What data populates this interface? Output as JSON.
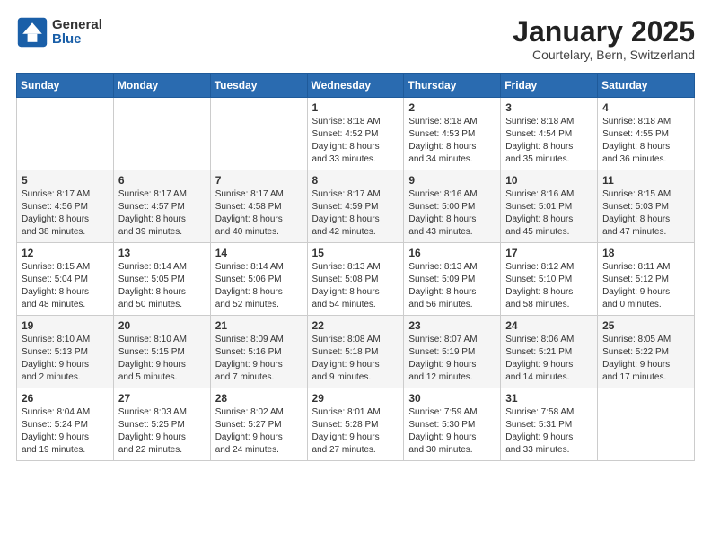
{
  "logo": {
    "general": "General",
    "blue": "Blue"
  },
  "header": {
    "month": "January 2025",
    "location": "Courtelary, Bern, Switzerland"
  },
  "weekdays": [
    "Sunday",
    "Monday",
    "Tuesday",
    "Wednesday",
    "Thursday",
    "Friday",
    "Saturday"
  ],
  "weeks": [
    [
      {
        "day": "",
        "info": ""
      },
      {
        "day": "",
        "info": ""
      },
      {
        "day": "",
        "info": ""
      },
      {
        "day": "1",
        "info": "Sunrise: 8:18 AM\nSunset: 4:52 PM\nDaylight: 8 hours\nand 33 minutes."
      },
      {
        "day": "2",
        "info": "Sunrise: 8:18 AM\nSunset: 4:53 PM\nDaylight: 8 hours\nand 34 minutes."
      },
      {
        "day": "3",
        "info": "Sunrise: 8:18 AM\nSunset: 4:54 PM\nDaylight: 8 hours\nand 35 minutes."
      },
      {
        "day": "4",
        "info": "Sunrise: 8:18 AM\nSunset: 4:55 PM\nDaylight: 8 hours\nand 36 minutes."
      }
    ],
    [
      {
        "day": "5",
        "info": "Sunrise: 8:17 AM\nSunset: 4:56 PM\nDaylight: 8 hours\nand 38 minutes."
      },
      {
        "day": "6",
        "info": "Sunrise: 8:17 AM\nSunset: 4:57 PM\nDaylight: 8 hours\nand 39 minutes."
      },
      {
        "day": "7",
        "info": "Sunrise: 8:17 AM\nSunset: 4:58 PM\nDaylight: 8 hours\nand 40 minutes."
      },
      {
        "day": "8",
        "info": "Sunrise: 8:17 AM\nSunset: 4:59 PM\nDaylight: 8 hours\nand 42 minutes."
      },
      {
        "day": "9",
        "info": "Sunrise: 8:16 AM\nSunset: 5:00 PM\nDaylight: 8 hours\nand 43 minutes."
      },
      {
        "day": "10",
        "info": "Sunrise: 8:16 AM\nSunset: 5:01 PM\nDaylight: 8 hours\nand 45 minutes."
      },
      {
        "day": "11",
        "info": "Sunrise: 8:15 AM\nSunset: 5:03 PM\nDaylight: 8 hours\nand 47 minutes."
      }
    ],
    [
      {
        "day": "12",
        "info": "Sunrise: 8:15 AM\nSunset: 5:04 PM\nDaylight: 8 hours\nand 48 minutes."
      },
      {
        "day": "13",
        "info": "Sunrise: 8:14 AM\nSunset: 5:05 PM\nDaylight: 8 hours\nand 50 minutes."
      },
      {
        "day": "14",
        "info": "Sunrise: 8:14 AM\nSunset: 5:06 PM\nDaylight: 8 hours\nand 52 minutes."
      },
      {
        "day": "15",
        "info": "Sunrise: 8:13 AM\nSunset: 5:08 PM\nDaylight: 8 hours\nand 54 minutes."
      },
      {
        "day": "16",
        "info": "Sunrise: 8:13 AM\nSunset: 5:09 PM\nDaylight: 8 hours\nand 56 minutes."
      },
      {
        "day": "17",
        "info": "Sunrise: 8:12 AM\nSunset: 5:10 PM\nDaylight: 8 hours\nand 58 minutes."
      },
      {
        "day": "18",
        "info": "Sunrise: 8:11 AM\nSunset: 5:12 PM\nDaylight: 9 hours\nand 0 minutes."
      }
    ],
    [
      {
        "day": "19",
        "info": "Sunrise: 8:10 AM\nSunset: 5:13 PM\nDaylight: 9 hours\nand 2 minutes."
      },
      {
        "day": "20",
        "info": "Sunrise: 8:10 AM\nSunset: 5:15 PM\nDaylight: 9 hours\nand 5 minutes."
      },
      {
        "day": "21",
        "info": "Sunrise: 8:09 AM\nSunset: 5:16 PM\nDaylight: 9 hours\nand 7 minutes."
      },
      {
        "day": "22",
        "info": "Sunrise: 8:08 AM\nSunset: 5:18 PM\nDaylight: 9 hours\nand 9 minutes."
      },
      {
        "day": "23",
        "info": "Sunrise: 8:07 AM\nSunset: 5:19 PM\nDaylight: 9 hours\nand 12 minutes."
      },
      {
        "day": "24",
        "info": "Sunrise: 8:06 AM\nSunset: 5:21 PM\nDaylight: 9 hours\nand 14 minutes."
      },
      {
        "day": "25",
        "info": "Sunrise: 8:05 AM\nSunset: 5:22 PM\nDaylight: 9 hours\nand 17 minutes."
      }
    ],
    [
      {
        "day": "26",
        "info": "Sunrise: 8:04 AM\nSunset: 5:24 PM\nDaylight: 9 hours\nand 19 minutes."
      },
      {
        "day": "27",
        "info": "Sunrise: 8:03 AM\nSunset: 5:25 PM\nDaylight: 9 hours\nand 22 minutes."
      },
      {
        "day": "28",
        "info": "Sunrise: 8:02 AM\nSunset: 5:27 PM\nDaylight: 9 hours\nand 24 minutes."
      },
      {
        "day": "29",
        "info": "Sunrise: 8:01 AM\nSunset: 5:28 PM\nDaylight: 9 hours\nand 27 minutes."
      },
      {
        "day": "30",
        "info": "Sunrise: 7:59 AM\nSunset: 5:30 PM\nDaylight: 9 hours\nand 30 minutes."
      },
      {
        "day": "31",
        "info": "Sunrise: 7:58 AM\nSunset: 5:31 PM\nDaylight: 9 hours\nand 33 minutes."
      },
      {
        "day": "",
        "info": ""
      }
    ]
  ]
}
